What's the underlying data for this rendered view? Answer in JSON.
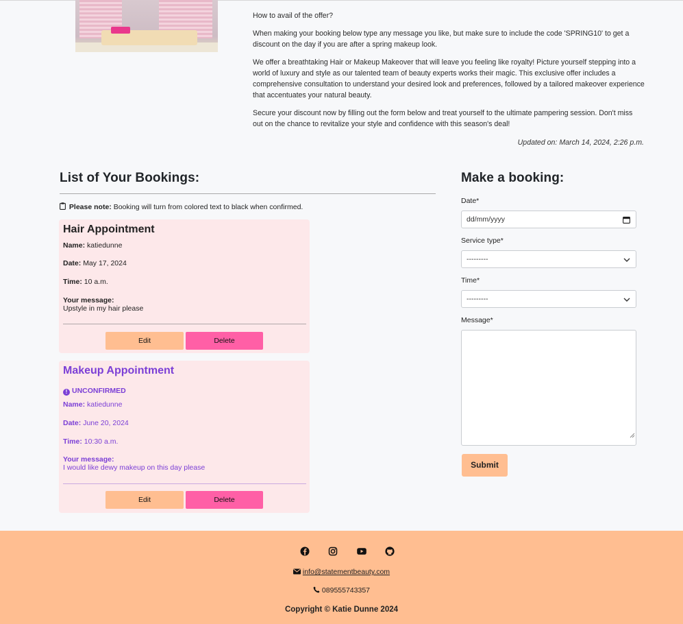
{
  "offer": {
    "paragraphs": [
      "How to avail of the offer?",
      "When making your booking below type any message you like, but make sure to include the code 'SPRING10' to get a discount on the day if you are after a spring makeup look.",
      "We offer a breathtaking Hair or Makeup Makeover that will leave you feeling like royalty! Picture yourself stepping into a world of luxury and style as our talented team of beauty experts works their magic. This exclusive offer includes a comprehensive consultation to understand your desired look and preferences, followed by a tailored makeover experience that accentuates your natural beauty.",
      "Secure your discount now by filling out the form below and treat yourself to the ultimate pampering session. Don't miss out on the chance to revitalize your style and confidence with this season's deal!"
    ],
    "updated": "Updated on: March 14, 2024, 2:26 p.m."
  },
  "bookings": {
    "title": "List of Your Bookings:",
    "note_label": "Please note:",
    "note_text": "Booking will turn from colored text to black when confirmed.",
    "items": [
      {
        "title": "Hair Appointment",
        "status": "",
        "name_label": "Name:",
        "name": "katiedunne",
        "date_label": "Date:",
        "date": "May 17, 2024",
        "time_label": "Time:",
        "time": "10 a.m.",
        "message_label": "Your message:",
        "message": "Upstyle in my hair please",
        "edit": "Edit",
        "delete": "Delete"
      },
      {
        "title": "Makeup Appointment",
        "status": "UNCONFIRMED",
        "name_label": "Name:",
        "name": "katiedunne",
        "date_label": "Date:",
        "date": "June 20, 2024",
        "time_label": "Time:",
        "time": "10:30 a.m.",
        "message_label": "Your message:",
        "message": "I would like dewy makeup on this day please",
        "edit": "Edit",
        "delete": "Delete"
      }
    ]
  },
  "form": {
    "title": "Make a booking:",
    "date_label": "Date*",
    "date_placeholder": "dd/mm/yyyy",
    "service_label": "Service type*",
    "service_value": "---------",
    "time_label": "Time*",
    "time_value": "---------",
    "message_label": "Message*",
    "submit": "Submit"
  },
  "footer": {
    "social_icons": [
      "facebook-icon",
      "instagram-icon",
      "youtube-icon",
      "github-icon"
    ],
    "email": "info@statementbeauty.com",
    "phone": "089555743357",
    "copyright": "Copyright © Katie Dunne 2024"
  },
  "colors": {
    "accent_peach": "#ffbe91",
    "accent_pink": "#ff5fa6",
    "unconfirmed_purple": "#7b3fd6",
    "card_bg": "#fde8ea"
  }
}
